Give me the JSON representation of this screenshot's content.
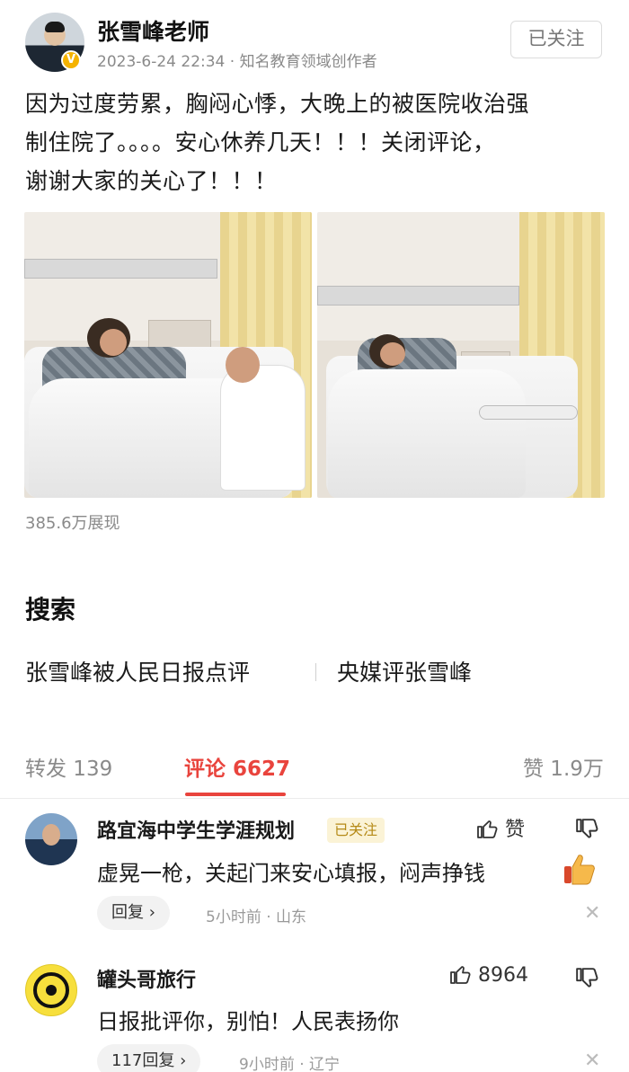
{
  "post": {
    "author": "张雪峰老师",
    "verified_mark": "V",
    "meta": "2023-6-24 22:34 · 知名教育领域创作者",
    "follow_label": "已关注",
    "text_lines": [
      "因为过度劳累，胸闷心悸，大晚上的被医院收治强",
      "制住院了。。。。安心休养几天！！！关闭评论，",
      "谢谢大家的关心了！！！"
    ],
    "views": "385.6万展现"
  },
  "search": {
    "title": "搜索",
    "links": [
      "张雪峰被人民日报点评",
      "央媒评张雪峰"
    ]
  },
  "tabs": {
    "repost": "转发 139",
    "comments": "评论 6627",
    "likes": "赞 1.9万",
    "active_color": "#e9443d"
  },
  "comments": [
    {
      "author": "路宜海中学生学涯规划",
      "badge": "已关注",
      "like_label": "赞",
      "text": "虚晃一枪，关起门来安心填报，闷声挣钱",
      "reply_label": "回复 ›",
      "meta": "5小时前 · 山东",
      "close": "✕"
    },
    {
      "author": "罐头哥旅行",
      "like_label": "8964",
      "text": "日报批评你，别怕！人民表扬你",
      "reply_label": "117回复 ›",
      "meta": "9小时前 · 辽宁",
      "close": "✕"
    }
  ],
  "icons": {
    "thumb_up": "thumb-up-icon",
    "thumb_down": "thumb-down-icon",
    "close": "close-icon",
    "emoji_thumb": "thumbs-up-emoji-icon"
  }
}
